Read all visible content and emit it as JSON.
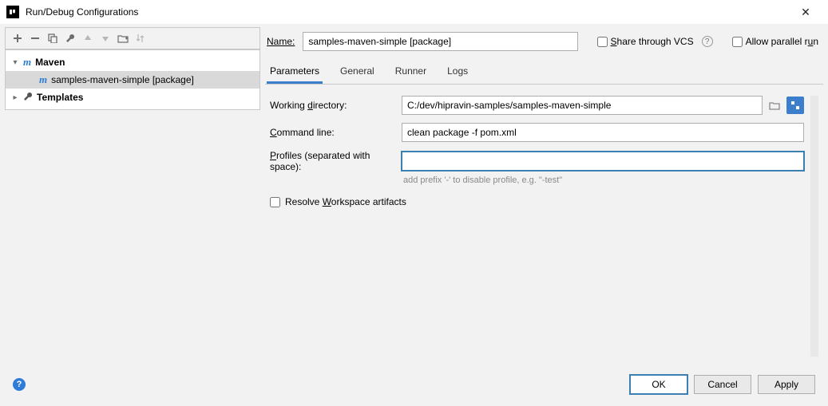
{
  "window": {
    "title": "Run/Debug Configurations"
  },
  "tree": {
    "root_maven": "Maven",
    "child_label": "samples-maven-simple [package]",
    "templates": "Templates"
  },
  "name_row": {
    "label": "Name:",
    "value": "samples-maven-simple [package]",
    "share_label": "Share through VCS",
    "allow_label": "Allow parallel run"
  },
  "tabs": {
    "parameters": "Parameters",
    "general": "General",
    "runner": "Runner",
    "logs": "Logs"
  },
  "form": {
    "working_dir_label": "Working directory:",
    "working_dir_value": "C:/dev/hipravin-samples/samples-maven-simple",
    "command_label": "Command line:",
    "command_value": "clean package -f pom.xml",
    "profiles_label": "Profiles (separated with space):",
    "profiles_value": "",
    "profiles_hint": "add prefix '-' to disable profile, e.g. \"-test\"",
    "resolve_label": "Resolve Workspace artifacts"
  },
  "footer": {
    "ok": "OK",
    "cancel": "Cancel",
    "apply": "Apply"
  }
}
